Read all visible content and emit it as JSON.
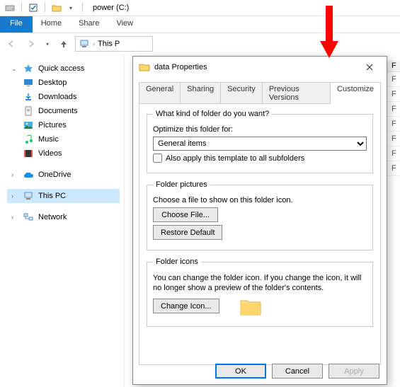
{
  "titlebar": {
    "drive_title": "power (C:)"
  },
  "ribbon": {
    "file": "File",
    "home": "Home",
    "share": "Share",
    "view": "View"
  },
  "address": {
    "location_prefix": "This P"
  },
  "nav": {
    "quick_access": "Quick access",
    "desktop": "Desktop",
    "downloads": "Downloads",
    "documents": "Documents",
    "pictures": "Pictures",
    "music": "Music",
    "videos": "Videos",
    "onedrive": "OneDrive",
    "this_pc": "This PC",
    "network": "Network"
  },
  "content": {
    "header": "F",
    "rows": [
      "F",
      "F",
      "F",
      "F",
      "F",
      "F",
      "F"
    ]
  },
  "dialog": {
    "title": "data Properties",
    "tabs": {
      "general": "General",
      "sharing": "Sharing",
      "security": "Security",
      "previous": "Previous Versions",
      "customize": "Customize"
    },
    "group1": {
      "legend": "What kind of folder do you want?",
      "optimize_label": "Optimize this folder for:",
      "select_value": "General items",
      "also_apply": "Also apply this template to all subfolders"
    },
    "group2": {
      "legend": "Folder pictures",
      "desc": "Choose a file to show on this folder icon.",
      "choose": "Choose File...",
      "restore": "Restore Default"
    },
    "group3": {
      "legend": "Folder icons",
      "desc": "You can change the folder icon. If you change the icon, it will no longer show a preview of the folder's contents.",
      "change": "Change Icon..."
    },
    "buttons": {
      "ok": "OK",
      "cancel": "Cancel",
      "apply": "Apply"
    }
  }
}
